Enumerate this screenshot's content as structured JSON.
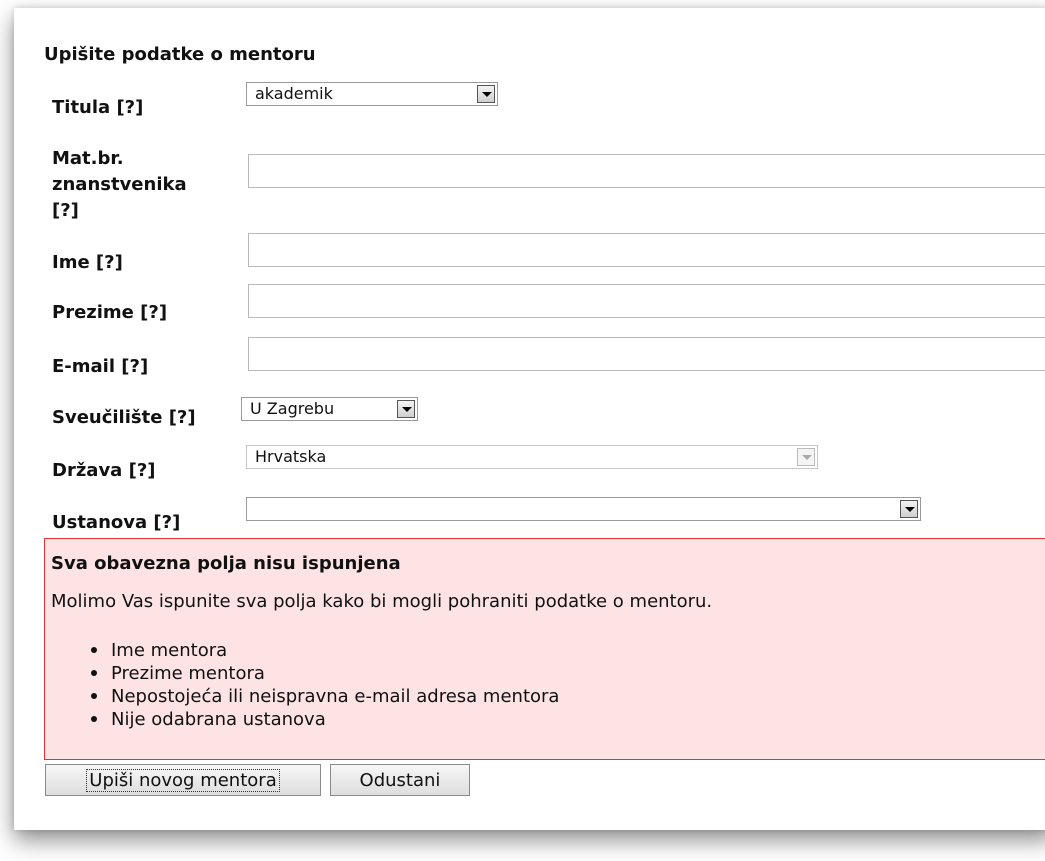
{
  "form": {
    "heading": "Upišite podatke o mentoru",
    "titula": {
      "label": "Titula [?]",
      "value": "akademik"
    },
    "mat_br": {
      "label_lines": [
        "Mat.br.",
        "znanstvenika",
        "[?]"
      ],
      "value": ""
    },
    "ime": {
      "label": "Ime [?]",
      "value": ""
    },
    "prezime": {
      "label": "Prezime [?]",
      "value": ""
    },
    "email": {
      "label": "E-mail [?]",
      "value": ""
    },
    "sveuciliste": {
      "label": "Sveučilište [?]",
      "value": "U Zagrebu"
    },
    "drzava": {
      "label": "Država [?]",
      "value": "Hrvatska"
    },
    "ustanova": {
      "label": "Ustanova [?]",
      "value": ""
    }
  },
  "error": {
    "title": "Sva obavezna polja nisu ispunjena",
    "message": "Molimo Vas ispunite sva polja kako bi mogli pohraniti podatke o mentoru.",
    "items": [
      "Ime mentora",
      "Prezime mentora",
      "Nepostojeća ili neispravna e-mail adresa mentora",
      "Nije odabrana ustanova"
    ],
    "background_color": "#fde3e3",
    "border_color": "#e63232"
  },
  "buttons": {
    "submit": "Upiši novog mentora",
    "cancel": "Odustani"
  }
}
